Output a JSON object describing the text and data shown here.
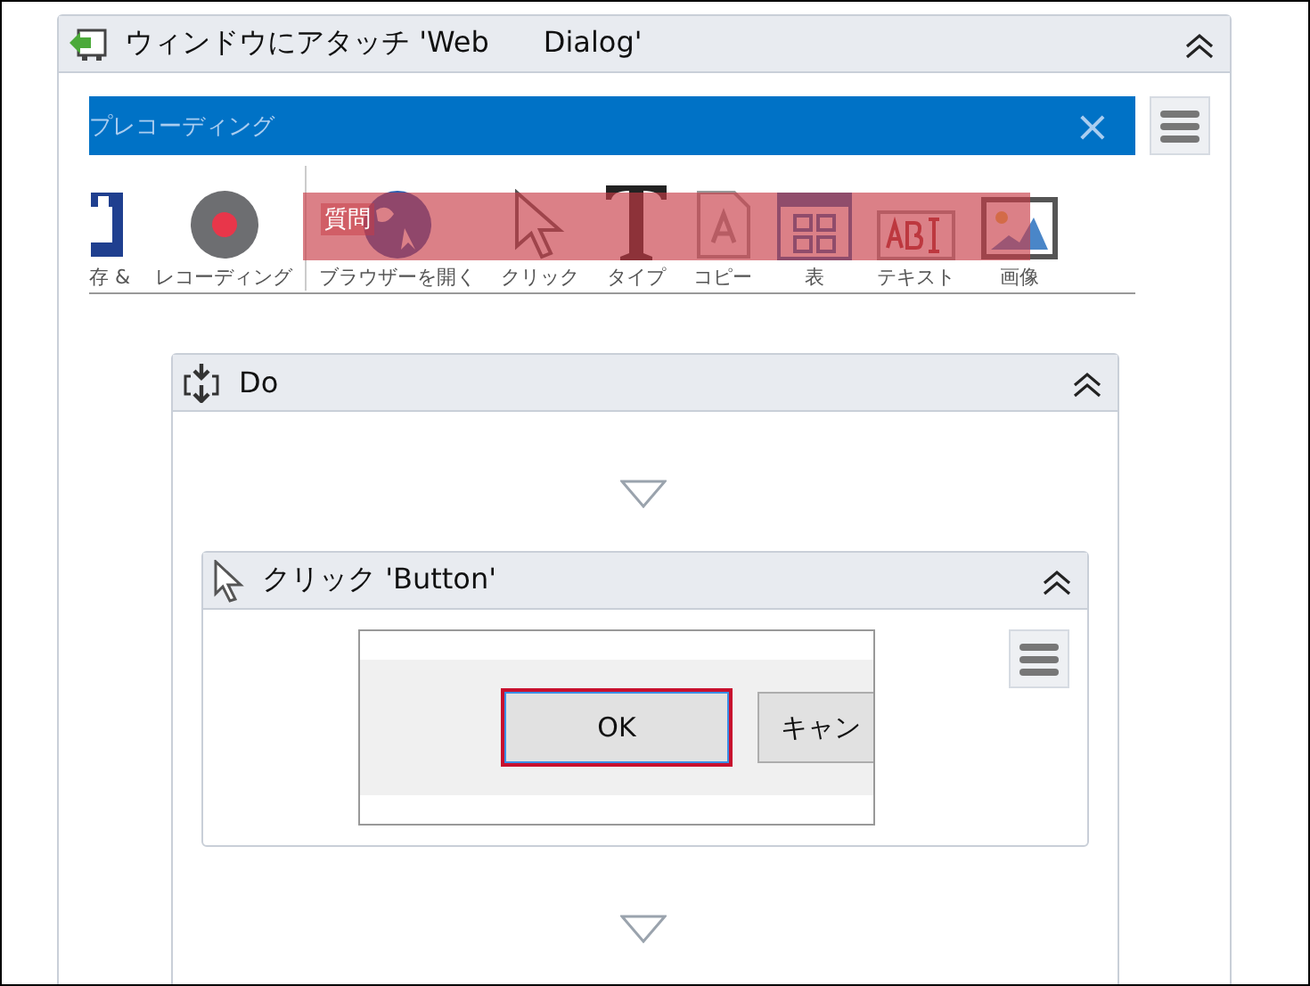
{
  "attach_activity": {
    "title": "ウィンドウにアタッチ 'Web      Dialog'",
    "expanded": true,
    "screenshot": {
      "title": "プレコーディング",
      "close": "×",
      "tools": [
        {
          "kind": "save",
          "label": "存 &"
        },
        {
          "kind": "record",
          "label": "レコーディング"
        },
        {
          "kind": "globe",
          "label": "ブラウザーを開く"
        },
        {
          "kind": "cursor",
          "label": "クリック"
        },
        {
          "kind": "type",
          "label": "タイプ"
        },
        {
          "kind": "copy",
          "label": "コピー"
        },
        {
          "kind": "table",
          "label": "表"
        },
        {
          "kind": "text",
          "label": "テキスト"
        },
        {
          "kind": "image",
          "label": "画像"
        }
      ],
      "overlay_label": "質問"
    },
    "do": {
      "title": "Do",
      "expanded": true,
      "click": {
        "title": "クリック 'Button'",
        "expanded": true,
        "screenshot": {
          "buttons": [
            {
              "label": "OK",
              "selected": true
            },
            {
              "label": "キャン",
              "selected": false
            }
          ]
        }
      }
    }
  }
}
